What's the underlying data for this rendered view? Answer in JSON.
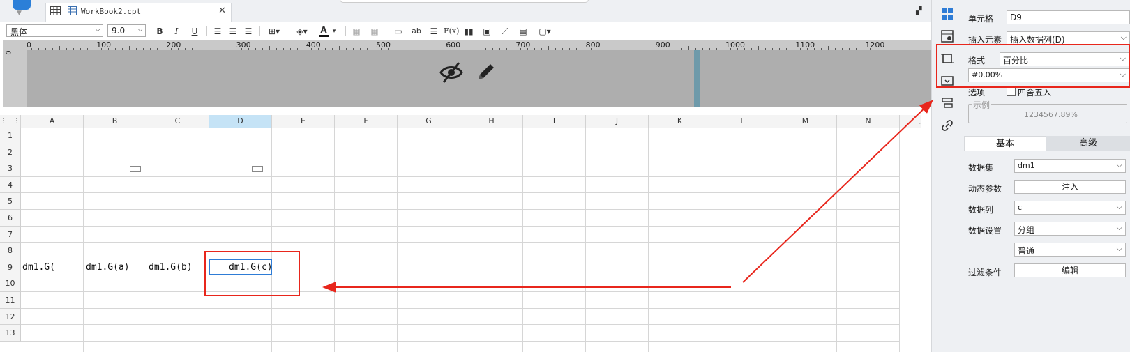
{
  "tabbar": {
    "file_title": "WorkBook2.cpt",
    "close_symbol": "✕"
  },
  "toolbar": {
    "font_family": "黑体",
    "font_size": "9.0",
    "bold": "B",
    "italic": "I",
    "underline": "U",
    "text_tool": "ab",
    "formula": "F(x)",
    "font_color_letter": "A"
  },
  "ruler": {
    "marks": [
      "0",
      "100",
      "200",
      "300",
      "400",
      "500",
      "600",
      "700",
      "800",
      "900",
      "1000",
      "1100",
      "1200"
    ],
    "vertical_zero": "0"
  },
  "grid": {
    "columns": [
      "A",
      "B",
      "C",
      "D",
      "E",
      "F",
      "G",
      "H",
      "I",
      "J",
      "K",
      "L",
      "M",
      "N"
    ],
    "selected_column": "D",
    "rows": [
      "1",
      "2",
      "3",
      "4",
      "5",
      "6",
      "7",
      "8",
      "9",
      "10",
      "11",
      "12",
      "13"
    ],
    "cells": {
      "A9": "dm1.G(",
      "B9": "dm1.G(a)",
      "C9": "dm1.G(b)",
      "D9": "dm1.G(c)"
    }
  },
  "panel": {
    "cell_label": "单元格",
    "cell_value": "D9",
    "insert_label": "插入元素",
    "insert_value": "插入数据列(D)",
    "format_label": "格式",
    "format_value": "百分比",
    "format_pattern": "#0.00%",
    "options_label": "选项",
    "round_label": "四舍五入",
    "round_checked": false,
    "example_label": "示例",
    "example_value": "1234567.89%",
    "tab_basic": "基本",
    "tab_advanced": "高级",
    "dataset_label": "数据集",
    "dataset_value": "dm1",
    "dynamic_param_label": "动态参数",
    "inject_button": "注入",
    "data_column_label": "数据列",
    "data_column_value": "c",
    "data_setting_label": "数据设置",
    "data_setting_value": "分组",
    "data_setting_sub_value": "普通",
    "filter_label": "过滤条件",
    "edit_button": "编辑"
  },
  "colors": {
    "accent": "#2e7cd6",
    "annotation_red": "#e8261c",
    "selected_header": "#c5e3f6",
    "band_gray": "#aeaeae"
  }
}
